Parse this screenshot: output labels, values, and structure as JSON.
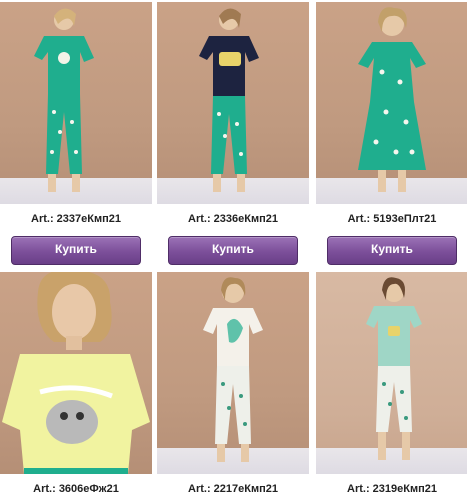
{
  "products": [
    {
      "art": "Art.: 2337еКмп21",
      "buy": "Купить"
    },
    {
      "art": "Art.: 2336еКмп21",
      "buy": "Купить"
    },
    {
      "art": "Art.: 5193еПлт21",
      "buy": "Купить"
    },
    {
      "art": "Art.: 3606еФж21"
    },
    {
      "art": "Art.: 2217еКмп21"
    },
    {
      "art": "Art.: 2319еКмп21"
    }
  ],
  "colors": {
    "button": "#7c4f9a",
    "teal": "#1fae8e",
    "navy": "#1d2340",
    "yellow": "#f1f3a0",
    "mint": "#9fd6c6"
  }
}
